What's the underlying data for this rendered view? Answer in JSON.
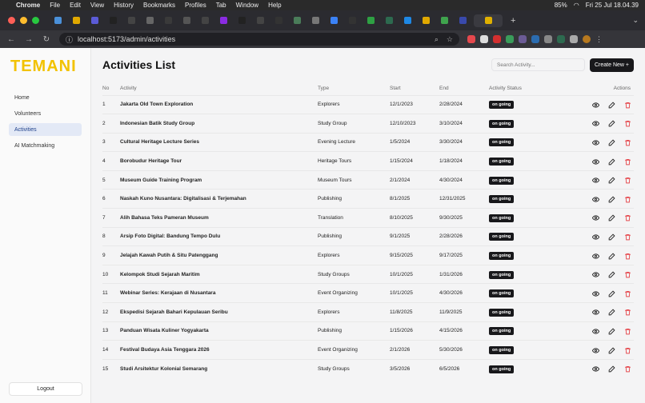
{
  "menubar": {
    "app": "Chrome",
    "items": [
      "File",
      "Edit",
      "View",
      "History",
      "Bookmarks",
      "Profiles",
      "Tab",
      "Window",
      "Help"
    ],
    "battery": "85%",
    "datetime": "Fri 25 Jul  18.04.39"
  },
  "browser": {
    "url": "localhost:5173/admin/activities",
    "tabs": 24
  },
  "sidebar": {
    "logo": "TEMANI",
    "items": [
      {
        "label": "Home"
      },
      {
        "label": "Volunteers"
      },
      {
        "label": "Activities"
      },
      {
        "label": "AI Matchmaking"
      }
    ],
    "logout": "Logout"
  },
  "header": {
    "title": "Activities List",
    "search_placeholder": "Search Activity...",
    "create_label": "Create New +"
  },
  "table": {
    "columns": [
      "No",
      "Activity",
      "Type",
      "Start",
      "End",
      "Activity Status",
      "Actions"
    ],
    "rows": [
      {
        "no": "1",
        "activity": "Jakarta Old Town Exploration",
        "type": "Explorers",
        "start": "12/1/2023",
        "end": "2/28/2024",
        "status": "on going"
      },
      {
        "no": "2",
        "activity": "Indonesian Batik Study Group",
        "type": "Study Group",
        "start": "12/10/2023",
        "end": "3/10/2024",
        "status": "on going"
      },
      {
        "no": "3",
        "activity": "Cultural Heritage Lecture Series",
        "type": "Evening Lecture",
        "start": "1/5/2024",
        "end": "3/30/2024",
        "status": "on going"
      },
      {
        "no": "4",
        "activity": "Borobudur Heritage Tour",
        "type": "Heritage Tours",
        "start": "1/15/2024",
        "end": "1/18/2024",
        "status": "on going"
      },
      {
        "no": "5",
        "activity": "Museum Guide Training Program",
        "type": "Museum Tours",
        "start": "2/1/2024",
        "end": "4/30/2024",
        "status": "on going"
      },
      {
        "no": "6",
        "activity": "Naskah Kuno Nusantara: Digitalisasi & Terjemahan",
        "type": "Publishing",
        "start": "8/1/2025",
        "end": "12/31/2025",
        "status": "on going"
      },
      {
        "no": "7",
        "activity": "Alih Bahasa Teks Pameran Museum",
        "type": "Translation",
        "start": "8/10/2025",
        "end": "9/30/2025",
        "status": "on going"
      },
      {
        "no": "8",
        "activity": "Arsip Foto Digital: Bandung Tempo Dulu",
        "type": "Publishing",
        "start": "9/1/2025",
        "end": "2/28/2026",
        "status": "on going"
      },
      {
        "no": "9",
        "activity": "Jelajah Kawah Putih & Situ Patenggang",
        "type": "Explorers",
        "start": "9/15/2025",
        "end": "9/17/2025",
        "status": "on going"
      },
      {
        "no": "10",
        "activity": "Kelompok Studi Sejarah Maritim",
        "type": "Study Groups",
        "start": "10/1/2025",
        "end": "1/31/2026",
        "status": "on going"
      },
      {
        "no": "11",
        "activity": "Webinar Series: Kerajaan di Nusantara",
        "type": "Event Organizing",
        "start": "10/1/2025",
        "end": "4/30/2026",
        "status": "on going"
      },
      {
        "no": "12",
        "activity": "Ekspedisi Sejarah Bahari Kepulauan Seribu",
        "type": "Explorers",
        "start": "11/8/2025",
        "end": "11/9/2025",
        "status": "on going"
      },
      {
        "no": "13",
        "activity": "Panduan Wisata Kuliner Yogyakarta",
        "type": "Publishing",
        "start": "1/15/2026",
        "end": "4/15/2026",
        "status": "on going"
      },
      {
        "no": "14",
        "activity": "Festival Budaya Asia Tenggara 2026",
        "type": "Event Organizing",
        "start": "2/1/2026",
        "end": "5/30/2026",
        "status": "on going"
      },
      {
        "no": "15",
        "activity": "Studi Arsitektur Kolonial Semarang",
        "type": "Study Groups",
        "start": "3/5/2026",
        "end": "6/5/2026",
        "status": "on going"
      }
    ]
  },
  "colors": {
    "accent": "#f2c200",
    "active_nav_bg": "#e3e9f6",
    "delete": "#e5484d"
  }
}
